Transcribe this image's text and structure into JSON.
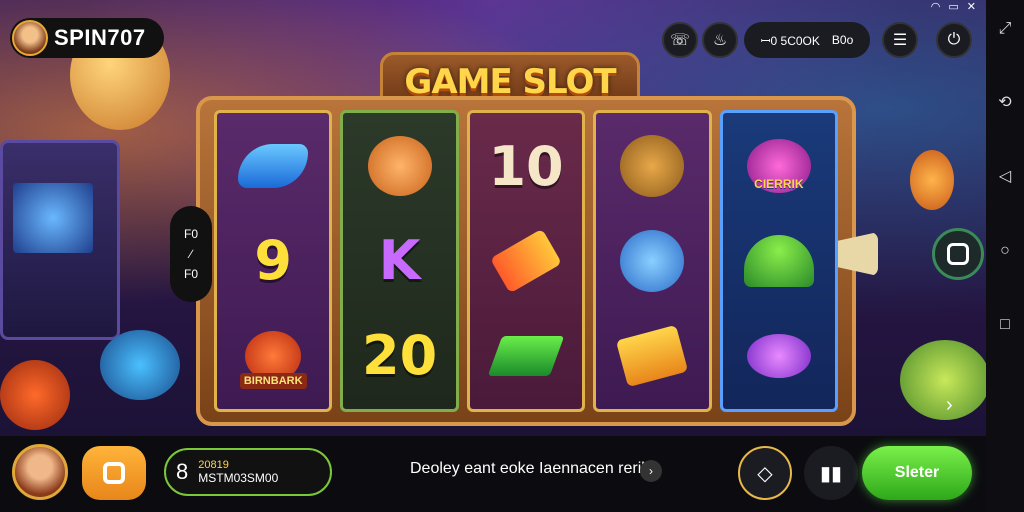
{
  "status_bar": {
    "icons": [
      "wifi-icon",
      "battery-icon",
      "close-icon"
    ]
  },
  "brand": {
    "name": "SPIN707"
  },
  "top_bar": {
    "balance_left": "ꟷ0 5C0OK",
    "balance_right": "B0o"
  },
  "title": "GAME SLOT",
  "reels": [
    {
      "symbols": [
        {
          "icon": "fish-icon",
          "text": ""
        },
        {
          "icon": "nine",
          "text": "9"
        },
        {
          "icon": "gift-icon",
          "text": "",
          "label": "BIRNBARK"
        }
      ]
    },
    {
      "symbols": [
        {
          "icon": "fox-icon",
          "text": ""
        },
        {
          "icon": "k",
          "text": "K"
        },
        {
          "icon": "twenty",
          "text": "20"
        }
      ]
    },
    {
      "symbols": [
        {
          "icon": "ten",
          "text": "10"
        },
        {
          "icon": "crossed-arrows-icon",
          "text": ""
        },
        {
          "icon": "green-bill-icon",
          "text": ""
        }
      ]
    },
    {
      "symbols": [
        {
          "icon": "cool-cat-icon",
          "text": ""
        },
        {
          "icon": "blue-cat-icon",
          "text": ""
        },
        {
          "icon": "gold-ticket-icon",
          "text": ""
        }
      ]
    },
    {
      "symbols": [
        {
          "icon": "easter-egg-icon",
          "text": "",
          "label": "CIERRIK"
        },
        {
          "icon": "cake-icon",
          "text": ""
        },
        {
          "icon": "purple-whistle-icon",
          "text": ""
        }
      ]
    }
  ],
  "side_control": {
    "top": "F0",
    "bottom": "F0"
  },
  "bottom_bar": {
    "credit_small": "8",
    "credit_line1": "20819",
    "credit_line2": "MSTM03SM00",
    "message": "Deoley eant eoke Iaennacen rerik"
  },
  "spin_button": "Sleter"
}
